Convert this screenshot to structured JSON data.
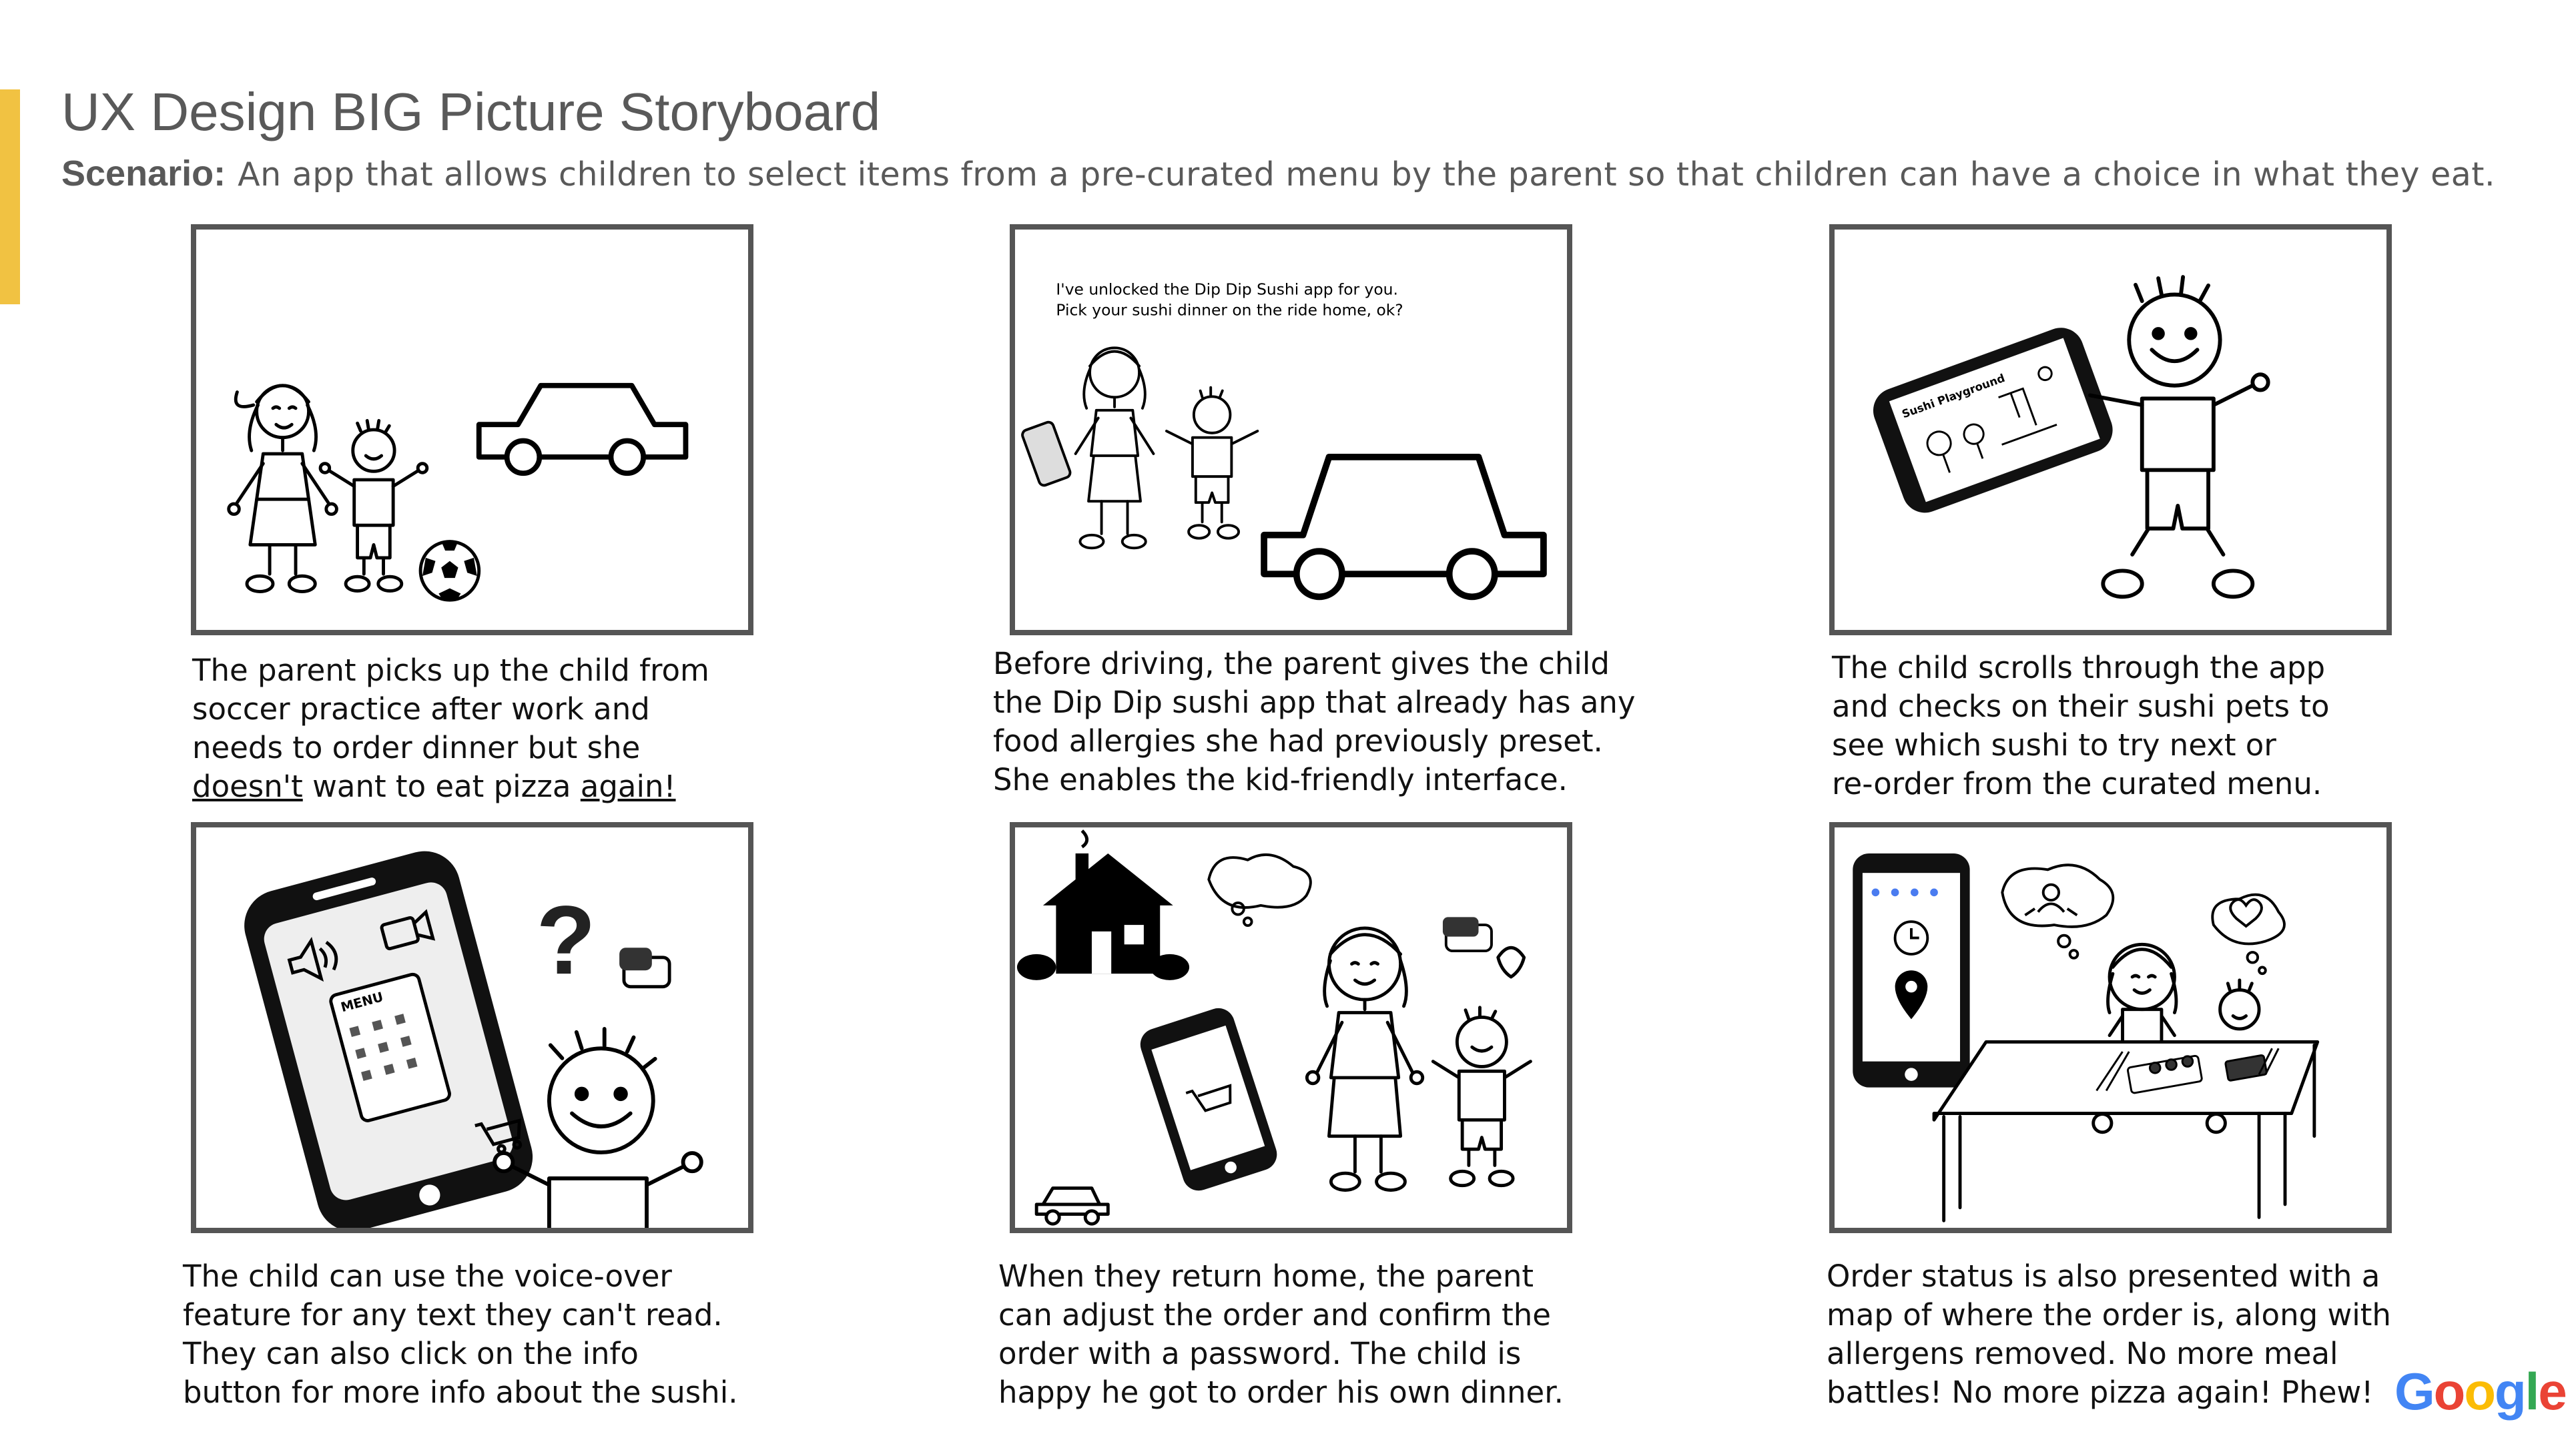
{
  "title": "UX Design BIG Picture Storyboard",
  "scenario": {
    "label": "Scenario:",
    "text": "An app that allows children to select items from a pre-curated menu by the parent so that children can have a choice in what they eat."
  },
  "panels": [
    {
      "caption_lines": [
        "The parent picks up the child from",
        "soccer practice after work and",
        "needs to order dinner but she"
      ],
      "caption_last": {
        "part1": "doesn't",
        "part2": " want to eat pizza ",
        "part3": "again!"
      }
    },
    {
      "speech_lines": [
        "I've unlocked the Dip Dip Sushi app for you.",
        "Pick your sushi dinner on the ride home, ok?"
      ],
      "caption_lines": [
        "Before driving, the parent gives the child",
        "the Dip Dip sushi app that already has any",
        "food allergies she had previously preset.",
        "She enables the kid-friendly interface."
      ]
    },
    {
      "phone_label": "Sushi Playground",
      "caption_lines": [
        "The child scrolls through the app",
        "and checks on their sushi pets to",
        "see which sushi to try next or",
        "re-order from the curated menu."
      ]
    },
    {
      "menu_label": "MENU",
      "question_mark": "?",
      "caption_lines": [
        "The child can use the voice-over",
        "feature for any text they can't read.",
        "They can also click on the info",
        "button for more info about the sushi."
      ]
    },
    {
      "caption_lines": [
        "When they return home, the parent",
        "can adjust the order and confirm the",
        "order with a password. The child is",
        "happy he got to order his own dinner."
      ]
    },
    {
      "caption_lines": [
        "Order status is also presented with a",
        "map of where the order is, along with",
        "allergens removed. No more meal",
        "battles! No more pizza again! Phew!"
      ]
    }
  ],
  "logo": {
    "letters": [
      "G",
      "o",
      "o",
      "g",
      "l",
      "e"
    ],
    "colors": [
      "#4285F4",
      "#EA4335",
      "#FBBC05",
      "#4285F4",
      "#34A853",
      "#EA4335"
    ]
  }
}
